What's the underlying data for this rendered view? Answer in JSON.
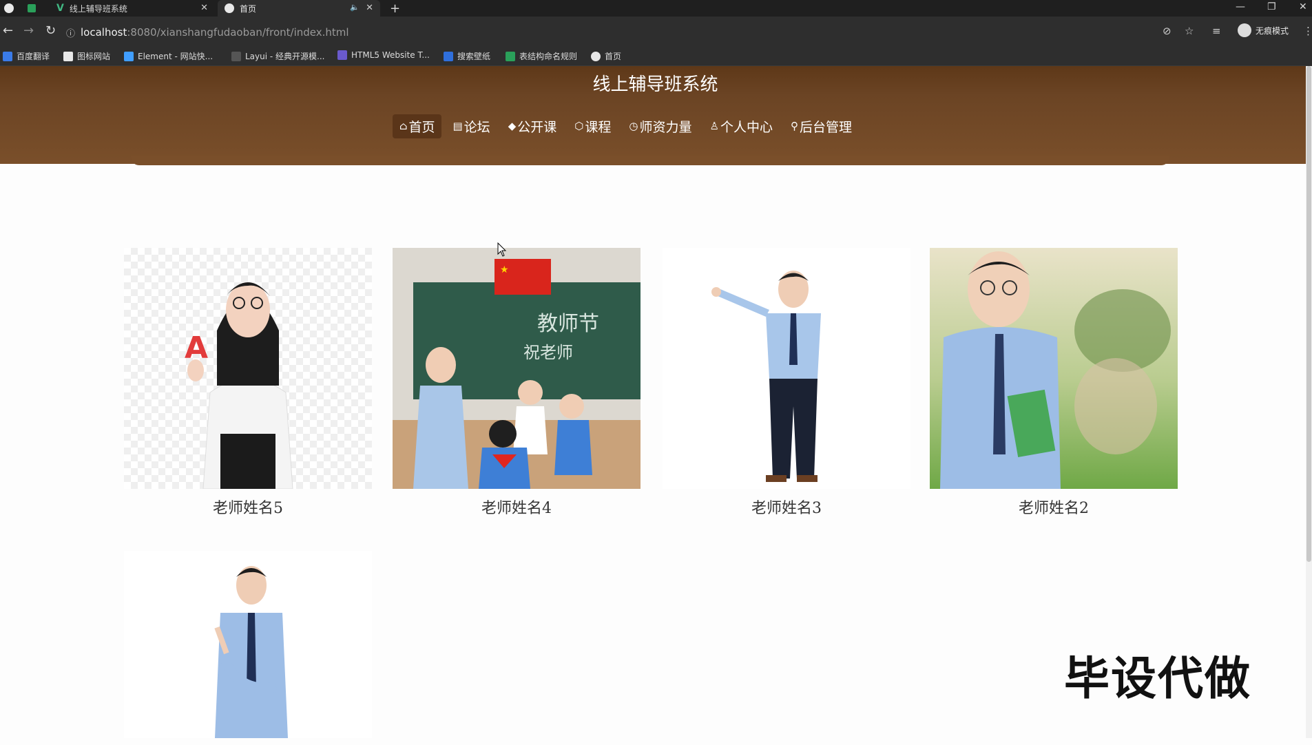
{
  "browser": {
    "tabs": [
      {
        "label": "",
        "icon": "app-tab-icon"
      },
      {
        "label": "线上辅导班系统",
        "icon": "vue-logo-icon"
      },
      {
        "label": "首页",
        "icon": "globe-icon"
      }
    ],
    "new_tab": "+",
    "address": {
      "host": "localhost",
      "path": ":8080/xianshangfudaoban/front/index.html"
    },
    "incognito_label": "无痕模式",
    "bookmarks": [
      "百度翻译",
      "图标网站",
      "Element - 网站快...",
      "Layui - 经典开源模...",
      "HTML5 Website T...",
      "搜索壁纸",
      "表结构命名规则",
      "首页"
    ]
  },
  "site": {
    "title": "线上辅导班系统",
    "nav": [
      {
        "label": "首页",
        "icon": "home-icon",
        "active": true
      },
      {
        "label": "论坛",
        "icon": "forum-icon"
      },
      {
        "label": "公开课",
        "icon": "graduation-cap-icon"
      },
      {
        "label": "课程",
        "icon": "course-icon"
      },
      {
        "label": "师资力量",
        "icon": "teacher-icon"
      },
      {
        "label": "个人中心",
        "icon": "user-icon"
      },
      {
        "label": "后台管理",
        "icon": "link-icon"
      }
    ]
  },
  "teachers": [
    {
      "name": "老师姓名5"
    },
    {
      "name": "老师姓名4"
    },
    {
      "name": "老师姓名3"
    },
    {
      "name": "老师姓名2"
    },
    {
      "name": ""
    }
  ],
  "watermark": "毕设代做",
  "colors": {
    "header_brown": "#6b4424",
    "active_nav": "#5a3519"
  }
}
